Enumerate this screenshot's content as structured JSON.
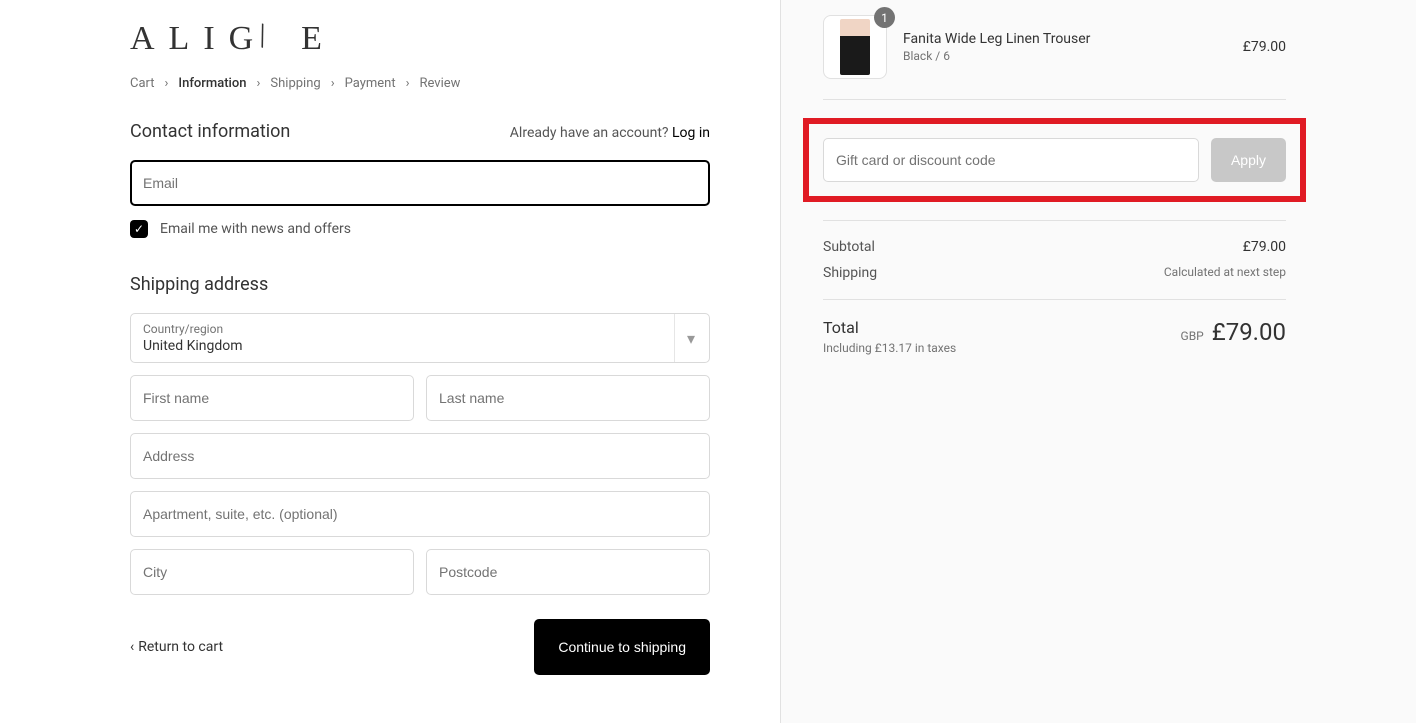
{
  "logo": "ALIGNE",
  "breadcrumb": {
    "items": [
      "Cart",
      "Information",
      "Shipping",
      "Payment",
      "Review"
    ],
    "activeIndex": 1
  },
  "contact": {
    "title": "Contact information",
    "accountPrompt": "Already have an account?",
    "loginText": "Log in",
    "emailPlaceholder": "Email",
    "newsletterLabel": "Email me with news and offers",
    "newsletterChecked": true
  },
  "shipping": {
    "title": "Shipping address",
    "countryLabel": "Country/region",
    "countryValue": "United Kingdom",
    "firstNamePlaceholder": "First name",
    "lastNamePlaceholder": "Last name",
    "addressPlaceholder": "Address",
    "address2Placeholder": "Apartment, suite, etc. (optional)",
    "cityPlaceholder": "City",
    "postcodePlaceholder": "Postcode"
  },
  "footer": {
    "returnText": "Return to cart",
    "continueText": "Continue to shipping"
  },
  "cart": {
    "product": {
      "name": "Fanita Wide Leg Linen Trouser",
      "variant": "Black / 6",
      "price": "£79.00",
      "qty": "1"
    },
    "discount": {
      "placeholder": "Gift card or discount code",
      "applyLabel": "Apply"
    },
    "subtotalLabel": "Subtotal",
    "subtotal": "£79.00",
    "shippingLabel": "Shipping",
    "shippingNote": "Calculated at next step",
    "totalLabel": "Total",
    "taxNote": "Including £13.17 in taxes",
    "currency": "GBP",
    "total": "£79.00"
  }
}
